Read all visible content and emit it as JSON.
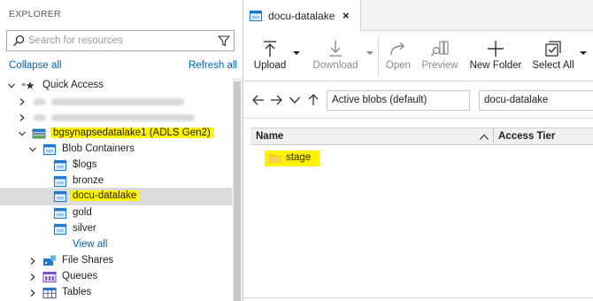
{
  "explorer": {
    "title": "EXPLORER",
    "search_placeholder": "Search for resources",
    "collapse_all": "Collapse all",
    "refresh_all": "Refresh all",
    "tree": {
      "quick_access": "Quick Access",
      "account": "bgsynapsedatalake1 (ADLS Gen2)",
      "blob_containers": "Blob Containers",
      "containers": [
        "$logs",
        "bronze",
        "docu-datalake",
        "gold",
        "silver"
      ],
      "view_all": "View all",
      "file_shares": "File Shares",
      "queues": "Queues",
      "tables": "Tables"
    }
  },
  "main": {
    "tab": {
      "label": "docu-datalake",
      "close": "×"
    },
    "toolbar": {
      "upload": "Upload",
      "download": "Download",
      "open": "Open",
      "preview": "Preview",
      "new_folder": "New Folder",
      "select_all": "Select All"
    },
    "nav": {
      "view_select": "Active blobs (default)",
      "path": "docu-datalake"
    },
    "grid": {
      "columns": [
        "Name",
        "Access Tier"
      ],
      "rows": [
        {
          "name": "stage"
        }
      ]
    }
  },
  "colors": {
    "highlight": "#fff200",
    "link": "#0063b1",
    "container_blue": "#1f7bd1",
    "folder_yellow": "#f5c518",
    "selected_row": "#dcdcdc"
  }
}
